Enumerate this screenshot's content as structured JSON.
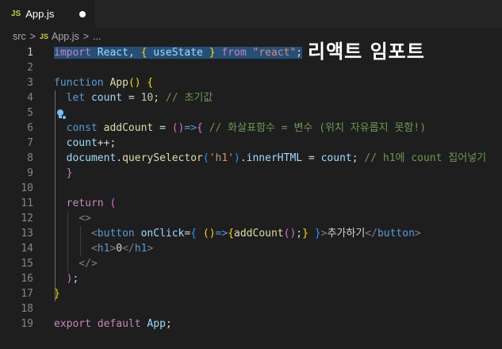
{
  "tab": {
    "badge": "JS",
    "filename": "App.js"
  },
  "breadcrumb": {
    "folder": "src",
    "badge": "JS",
    "file": "App.js",
    "more": "..."
  },
  "overlay_text": "리액트 임포트",
  "colors": {
    "background": "#1e1e1e",
    "selection": "#264f78",
    "keyword": "#c586c0",
    "comment": "#6a9955"
  },
  "lines": [
    {
      "n": "1",
      "parts": [
        [
          "import",
          "kw"
        ],
        [
          " ",
          "txt"
        ],
        [
          "React",
          "var"
        ],
        [
          ", ",
          "txt"
        ],
        [
          "{",
          "ylw"
        ],
        [
          " ",
          "txt"
        ],
        [
          "useState",
          "var"
        ],
        [
          " ",
          "txt"
        ],
        [
          "}",
          "ylw"
        ],
        [
          " ",
          "txt"
        ],
        [
          "from",
          "kw"
        ],
        [
          " ",
          "txt"
        ],
        [
          "\"react\"",
          "str"
        ],
        [
          ";",
          "txt"
        ]
      ]
    },
    {
      "n": "2",
      "parts": []
    },
    {
      "n": "3",
      "parts": [
        [
          "function",
          "st"
        ],
        [
          " ",
          "txt"
        ],
        [
          "App",
          "fn"
        ],
        [
          "()",
          "ylw"
        ],
        [
          " ",
          "txt"
        ],
        [
          "{",
          "ylw"
        ]
      ]
    },
    {
      "n": "4",
      "parts": [
        [
          "  ",
          "txt"
        ],
        [
          "let",
          "st"
        ],
        [
          " ",
          "txt"
        ],
        [
          "count",
          "var"
        ],
        [
          " = ",
          "txt"
        ],
        [
          "10",
          "num"
        ],
        [
          "; ",
          "txt"
        ],
        [
          "// 초기값",
          "com"
        ]
      ]
    },
    {
      "n": "5",
      "parts": []
    },
    {
      "n": "6",
      "parts": [
        [
          "  ",
          "txt"
        ],
        [
          "const",
          "st"
        ],
        [
          " ",
          "txt"
        ],
        [
          "addCount",
          "fn"
        ],
        [
          " = ",
          "txt"
        ],
        [
          "()",
          "pnk"
        ],
        [
          "=>",
          "st"
        ],
        [
          "{",
          "pnk"
        ],
        [
          " ",
          "txt"
        ],
        [
          "// 화살표함수 = 변수 (위치 자유롭지 못함!)",
          "com"
        ]
      ]
    },
    {
      "n": "7",
      "parts": [
        [
          "  ",
          "txt"
        ],
        [
          "count",
          "var"
        ],
        [
          "++;",
          "txt"
        ]
      ]
    },
    {
      "n": "8",
      "parts": [
        [
          "  ",
          "txt"
        ],
        [
          "document",
          "var"
        ],
        [
          ".",
          "txt"
        ],
        [
          "querySelector",
          "fn"
        ],
        [
          "(",
          "blu"
        ],
        [
          "'h1'",
          "str"
        ],
        [
          ")",
          "blu"
        ],
        [
          ".",
          "txt"
        ],
        [
          "innerHTML",
          "var"
        ],
        [
          " = ",
          "txt"
        ],
        [
          "count",
          "var"
        ],
        [
          "; ",
          "txt"
        ],
        [
          "// h1에 count 집어넣기",
          "com"
        ]
      ]
    },
    {
      "n": "9",
      "parts": [
        [
          "  ",
          "txt"
        ],
        [
          "}",
          "pnk"
        ]
      ]
    },
    {
      "n": "10",
      "parts": []
    },
    {
      "n": "11",
      "parts": [
        [
          "  ",
          "txt"
        ],
        [
          "return",
          "kw"
        ],
        [
          " ",
          "txt"
        ],
        [
          "(",
          "pnk"
        ]
      ]
    },
    {
      "n": "12",
      "parts": [
        [
          "    ",
          "txt"
        ],
        [
          "<>",
          "tagb"
        ]
      ]
    },
    {
      "n": "13",
      "parts": [
        [
          "      ",
          "txt"
        ],
        [
          "<",
          "tagb"
        ],
        [
          "button",
          "tag"
        ],
        [
          " ",
          "txt"
        ],
        [
          "onClick",
          "attr"
        ],
        [
          "=",
          "txt"
        ],
        [
          "{",
          "blu"
        ],
        [
          " ",
          "txt"
        ],
        [
          "()",
          "ylw"
        ],
        [
          "=>",
          "st"
        ],
        [
          "{",
          "ylw"
        ],
        [
          "addCount",
          "fn"
        ],
        [
          "()",
          "pnk"
        ],
        [
          ";",
          "txt"
        ],
        [
          "}",
          "ylw"
        ],
        [
          " ",
          "txt"
        ],
        [
          "}",
          "blu"
        ],
        [
          ">",
          "tagb"
        ],
        [
          "추가하기",
          "txt"
        ],
        [
          "</",
          "tagb"
        ],
        [
          "button",
          "tag"
        ],
        [
          ">",
          "tagb"
        ]
      ]
    },
    {
      "n": "14",
      "parts": [
        [
          "      ",
          "txt"
        ],
        [
          "<",
          "tagb"
        ],
        [
          "h1",
          "tag"
        ],
        [
          ">",
          "tagb"
        ],
        [
          "0",
          "txt"
        ],
        [
          "</",
          "tagb"
        ],
        [
          "h1",
          "tag"
        ],
        [
          ">",
          "tagb"
        ]
      ]
    },
    {
      "n": "15",
      "parts": [
        [
          "    ",
          "txt"
        ],
        [
          "</>",
          "tagb"
        ]
      ]
    },
    {
      "n": "16",
      "parts": [
        [
          "  ",
          "txt"
        ],
        [
          ")",
          "pnk"
        ],
        [
          ";",
          "txt"
        ]
      ]
    },
    {
      "n": "17",
      "parts": [
        [
          "}",
          "ylw"
        ]
      ]
    },
    {
      "n": "18",
      "parts": []
    },
    {
      "n": "19",
      "parts": [
        [
          "export",
          "kw"
        ],
        [
          " ",
          "txt"
        ],
        [
          "default",
          "kw"
        ],
        [
          " ",
          "txt"
        ],
        [
          "App",
          "var"
        ],
        [
          ";",
          "txt"
        ]
      ]
    }
  ]
}
